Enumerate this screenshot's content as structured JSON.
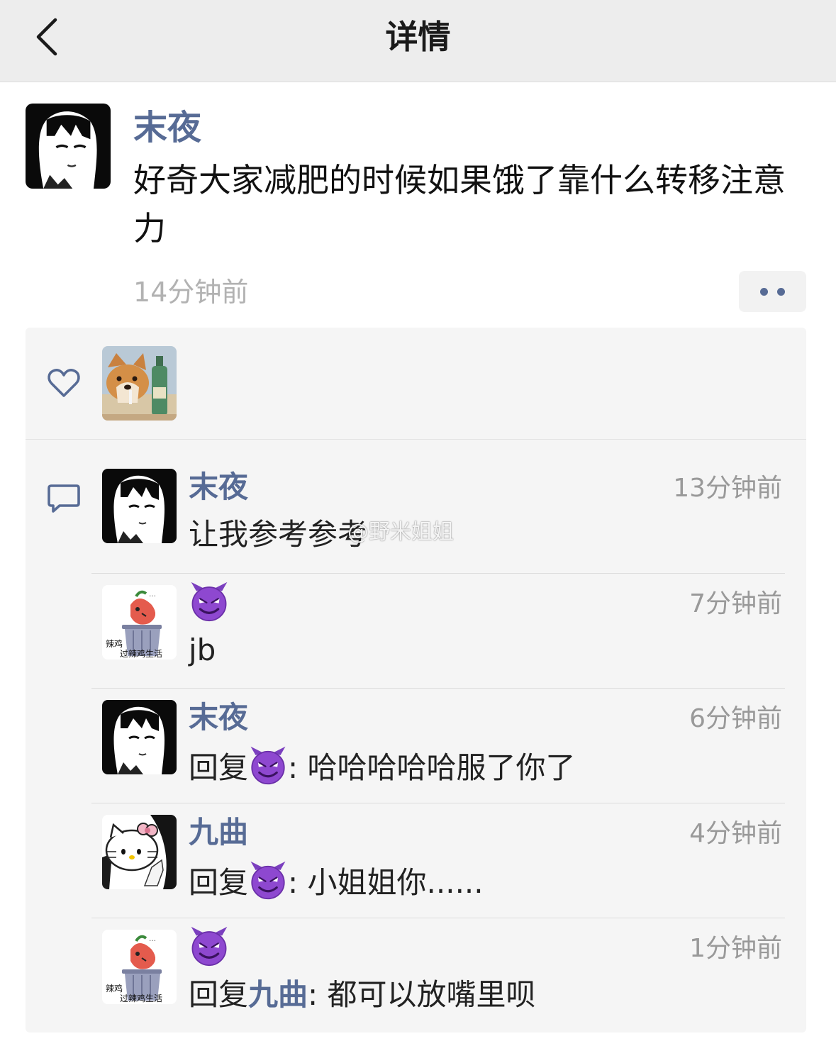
{
  "nav": {
    "title": "详情",
    "back_icon": "chevron-left-icon"
  },
  "post": {
    "author": "末夜",
    "text": "好奇大家减肥的时候如果饿了靠什么转移注意力",
    "time": "14分钟前",
    "more_icon": "ellipsis-icon"
  },
  "likes": {
    "icon": "heart-outline-icon"
  },
  "comments": [
    {
      "name": "末夜",
      "time": "13分钟前",
      "text": "让我参考参考"
    },
    {
      "name_emoji": "devil-emoji",
      "time": "7分钟前",
      "text": "jb"
    },
    {
      "name": "末夜",
      "time": "6分钟前",
      "reply_prefix": "回复",
      "reply_to_emoji": "devil-emoji",
      "text": ": 哈哈哈哈哈服了你了"
    },
    {
      "name": "九曲",
      "time": "4分钟前",
      "reply_prefix": "回复",
      "reply_to_emoji": "devil-emoji",
      "text": ": 小姐姐你......"
    },
    {
      "name_emoji": "devil-emoji",
      "time": "1分钟前",
      "reply_prefix": "回复",
      "reply_to": "九曲",
      "text": ": 都可以放嘴里呗"
    }
  ],
  "avatar_caption": {
    "line1": "辣鸡",
    "line2": "过辣鸡生活"
  },
  "watermark": "@野米姐姐",
  "colors": {
    "link_blue": "#576b95",
    "devil_purple": "#7b3fbf",
    "nav_bg": "#ededed",
    "panel_bg": "#f5f5f5"
  }
}
